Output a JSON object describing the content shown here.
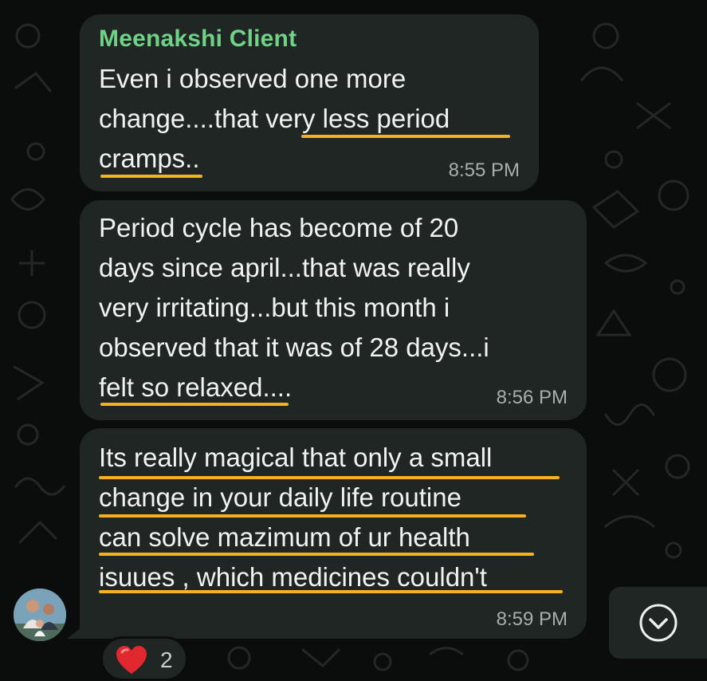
{
  "messages": [
    {
      "sender": "Meenakshi Client",
      "text": "Even i observed one more\nchange....that very less period\ncramps..",
      "time": "8:55 PM"
    },
    {
      "text": "Period cycle has become of 20\ndays since april...that was really\nvery irritating...but this month i\nobserved that it was of 28 days...i\nfelt so relaxed....",
      "time": "8:56 PM"
    },
    {
      "text": "Its really magical that only a small\nchange in your daily life routine\ncan solve mazimum of ur health\nisuues , which medicines couldn't",
      "time": "8:59 PM"
    }
  ],
  "reaction": {
    "emoji": "heart-icon",
    "count": "2"
  },
  "colors": {
    "background": "#0b0d0c",
    "bubble": "#202624",
    "sender_name": "#6fd287",
    "highlight_underline": "#f4b21f",
    "timestamp": "#a7aeab"
  },
  "icons": {
    "scroll_down": "chevron-down-circle-icon",
    "avatar": "avatar"
  }
}
